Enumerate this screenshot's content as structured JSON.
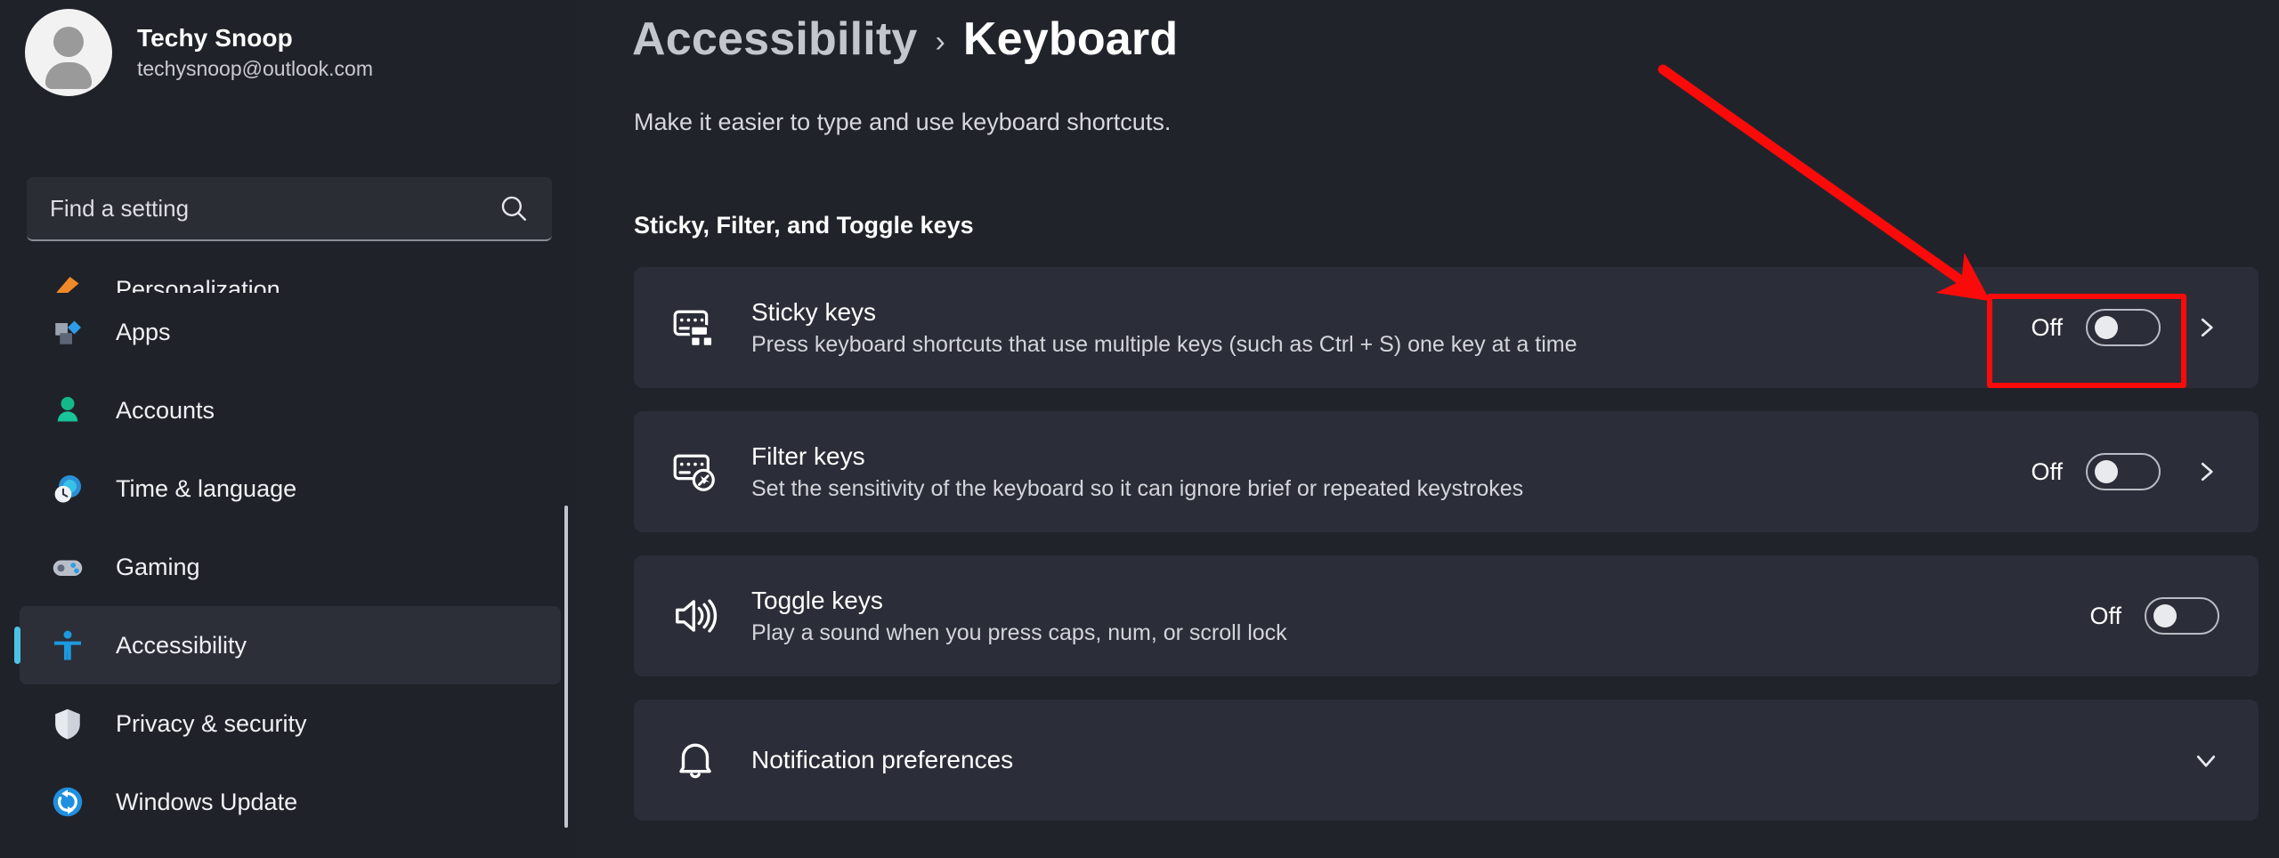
{
  "account": {
    "name": "Techy Snoop",
    "email": "techysnoop@outlook.com",
    "avatar_icon": "person-avatar-icon"
  },
  "search": {
    "placeholder": "Find a setting",
    "icon": "search-icon"
  },
  "sidebar": {
    "items": [
      {
        "label": "Personalization",
        "icon": "personalization-icon",
        "selected": false,
        "partial": true
      },
      {
        "label": "Apps",
        "icon": "apps-icon",
        "selected": false,
        "partial": false
      },
      {
        "label": "Accounts",
        "icon": "accounts-icon",
        "selected": false,
        "partial": false
      },
      {
        "label": "Time & language",
        "icon": "time-language-icon",
        "selected": false,
        "partial": false
      },
      {
        "label": "Gaming",
        "icon": "gaming-icon",
        "selected": false,
        "partial": false
      },
      {
        "label": "Accessibility",
        "icon": "accessibility-icon",
        "selected": true,
        "partial": false
      },
      {
        "label": "Privacy & security",
        "icon": "shield-icon",
        "selected": false,
        "partial": false
      },
      {
        "label": "Windows Update",
        "icon": "windows-update-icon",
        "selected": false,
        "partial": false
      }
    ]
  },
  "header": {
    "breadcrumb_root": "Accessibility",
    "breadcrumb_separator": "›",
    "breadcrumb_leaf": "Keyboard",
    "subtitle": "Make it easier to type and use keyboard shortcuts."
  },
  "section": {
    "title": "Sticky, Filter, and Toggle keys"
  },
  "rows": [
    {
      "title": "Sticky keys",
      "desc": "Press keyboard shortcuts that use multiple keys (such as Ctrl + S) one key at a time",
      "icon": "sticky-keys-icon",
      "toggle_label": "Off",
      "toggle_on": false,
      "has_toggle": true,
      "has_chevron_right": true,
      "has_chevron_down": false,
      "highlighted": true
    },
    {
      "title": "Filter keys",
      "desc": "Set the sensitivity of the keyboard so it can ignore brief or repeated keystrokes",
      "icon": "filter-keys-icon",
      "toggle_label": "Off",
      "toggle_on": false,
      "has_toggle": true,
      "has_chevron_right": true,
      "has_chevron_down": false,
      "highlighted": false
    },
    {
      "title": "Toggle keys",
      "desc": "Play a sound when you press caps, num, or scroll lock",
      "icon": "speaker-icon",
      "toggle_label": "Off",
      "toggle_on": false,
      "has_toggle": true,
      "has_chevron_right": false,
      "has_chevron_down": false,
      "highlighted": false
    },
    {
      "title": "Notification preferences",
      "desc": "",
      "icon": "bell-icon",
      "toggle_label": "",
      "toggle_on": false,
      "has_toggle": false,
      "has_chevron_right": false,
      "has_chevron_down": true,
      "highlighted": false
    }
  ],
  "annotation": {
    "color": "#fb0a0a",
    "arrow_icon": "red-arrow-icon",
    "box_icon": "red-highlight-box"
  }
}
